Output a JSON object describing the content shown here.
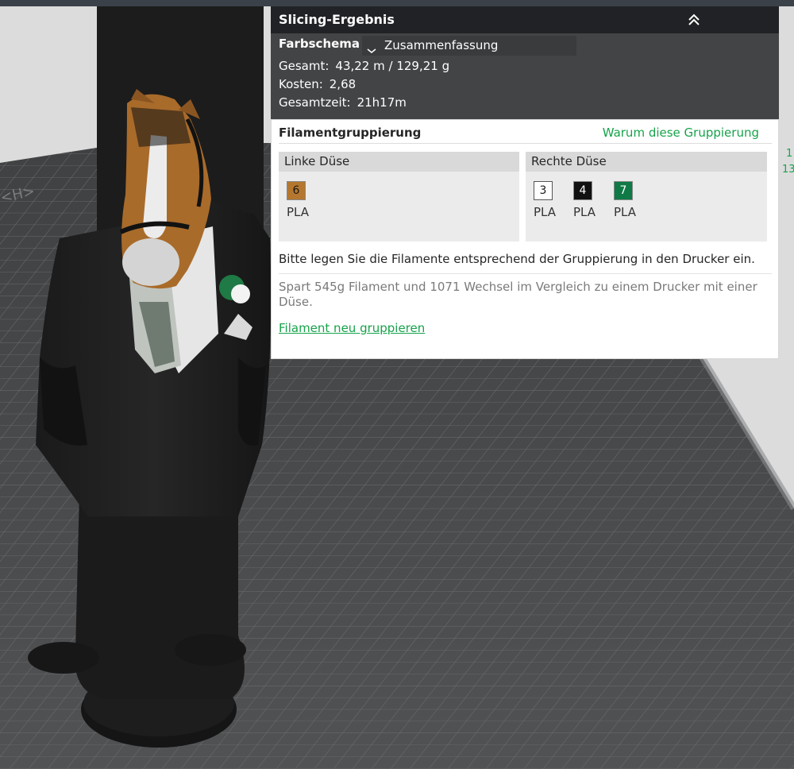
{
  "result": {
    "title": "Slicing-Ergebnis",
    "color_scheme_label": "Farbschema",
    "color_scheme_value": "Zusammenfassung",
    "total_label": "Gesamt:",
    "total_value": "43,22 m / 129,21 g",
    "cost_label": "Kosten:",
    "cost_value": "2,68",
    "time_label": "Gesamtzeit:",
    "time_value": "21h17m"
  },
  "grouping": {
    "title": "Filamentgruppierung",
    "why_link": "Warum diese Gruppierung",
    "left_nozzle": {
      "label": "Linke Düse",
      "filaments": [
        {
          "num": "6",
          "type": "PLA",
          "color": "#b5772f"
        }
      ]
    },
    "right_nozzle": {
      "label": "Rechte Düse",
      "filaments": [
        {
          "num": "3",
          "type": "PLA",
          "color": "#ffffff"
        },
        {
          "num": "4",
          "type": "PLA",
          "color": "#111111"
        },
        {
          "num": "7",
          "type": "PLA",
          "color": "#0f7a45"
        }
      ]
    },
    "instruction": "Bitte legen Sie die Filamente entsprechend der Gruppierung in den Drucker ein.",
    "savings": "Spart 545g Filament und 1071 Wechsel im Vergleich zu einem Drucker mit einer Düse.",
    "regroup_link": "Filament neu gruppieren"
  },
  "side_values": [
    "1",
    "13"
  ],
  "colors": {
    "accent": "#16a34a",
    "panel_dark": "#2a2b2d",
    "bed": "#4a4b4d"
  }
}
